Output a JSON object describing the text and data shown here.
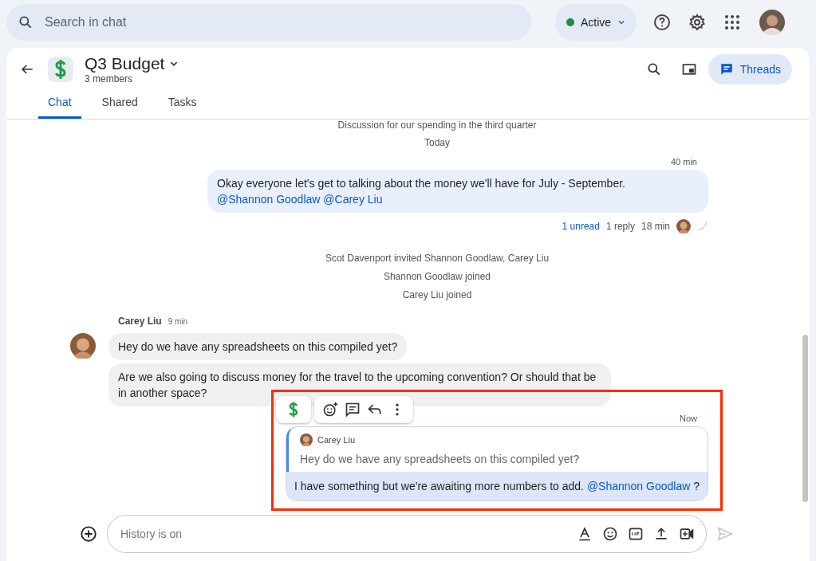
{
  "search": {
    "placeholder": "Search in chat"
  },
  "status": {
    "label": "Active",
    "color": "#1e8e3e"
  },
  "space": {
    "title": "Q3 Budget",
    "members": "3 members"
  },
  "threads_button": {
    "label": "Threads",
    "selected": true
  },
  "tabs": [
    {
      "label": "Chat",
      "selected": true
    },
    {
      "label": "Shared",
      "selected": false
    },
    {
      "label": "Tasks",
      "selected": false
    }
  ],
  "feed": [
    {
      "kind": "system",
      "text": "Discussion for our spending in the third quarter"
    },
    {
      "kind": "date",
      "text": "Today"
    },
    {
      "kind": "own",
      "time": "40 min",
      "parts": [
        {
          "kind": "text",
          "text": "Okay everyone let's get to talking about the money we'll have  for July - September. "
        },
        {
          "kind": "mention",
          "text": "@Shannon Goodlaw"
        },
        {
          "kind": "mention",
          "text": "@Carey Liu"
        }
      ],
      "thread": {
        "unread": "1 unread",
        "replies": "1 reply",
        "time": "18 min"
      }
    },
    {
      "kind": "system",
      "text": "Scot Davenport invited Shannon Goodlaw, Carey Liu"
    },
    {
      "kind": "system",
      "text": "Shannon Goodlaw joined"
    },
    {
      "kind": "system",
      "text": "Carey Liu joined"
    },
    {
      "kind": "group",
      "sender": "Carey Liu",
      "time": "9 min",
      "messages": [
        [
          {
            "kind": "text",
            "text": "Hey do we have any spreadsheets on this compiled yet?"
          }
        ],
        [
          {
            "kind": "text",
            "text": "Are we also going to discuss money for the travel to the upcoming convention? Or should that be in another space?"
          }
        ]
      ]
    },
    {
      "kind": "quote_reply",
      "time": "Now",
      "highlighted": true,
      "quote": {
        "sender": "Carey Liu",
        "text": "Hey do we have any spreadsheets on this compiled yet?"
      },
      "parts": [
        {
          "kind": "text",
          "text": "I have something but we're awaiting more numbers to add. "
        },
        {
          "kind": "mention",
          "text": "@Shannon Goodlaw"
        },
        {
          "kind": "text",
          "text": " ?"
        }
      ]
    }
  ],
  "composer": {
    "placeholder": "History is on",
    "send_enabled": false
  }
}
